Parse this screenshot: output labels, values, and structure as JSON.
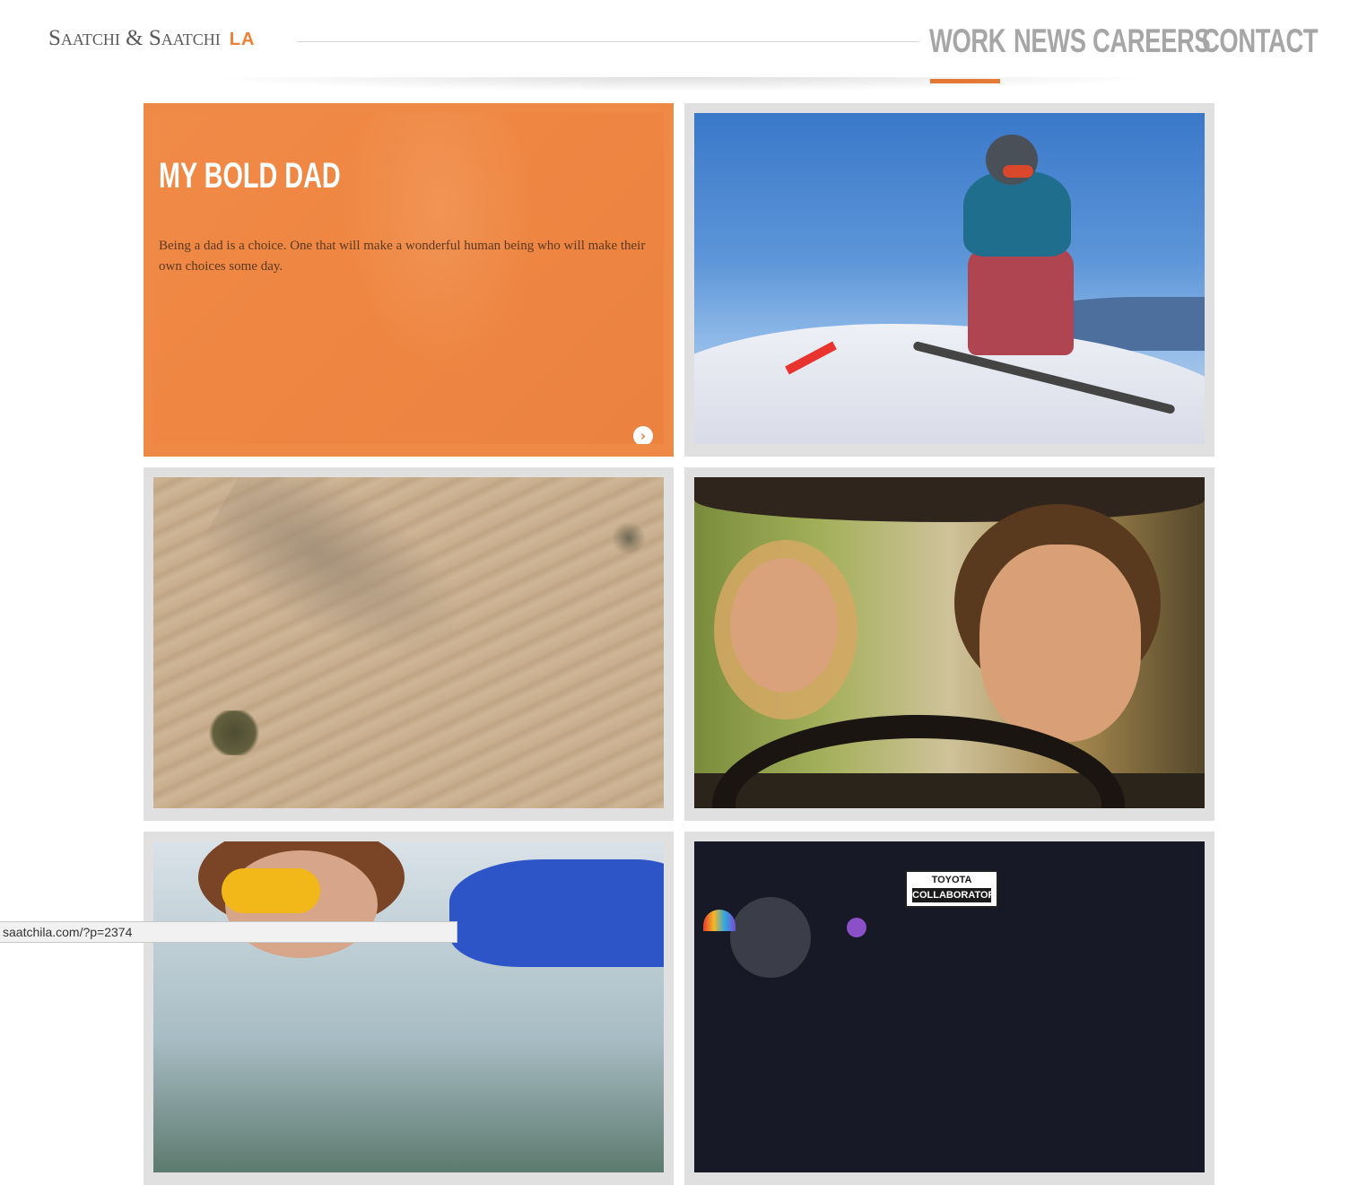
{
  "header": {
    "logo_text": "Saatchi & Saatchi",
    "logo_suffix": "LA",
    "nav": [
      {
        "label": "WORK"
      },
      {
        "label": "NEWS"
      },
      {
        "label": "CAREERS"
      },
      {
        "label": "CONTACT"
      }
    ],
    "active_nav": "WORK"
  },
  "featured": {
    "title": "MY BOLD DAD",
    "description": "Being a dad is a choice. One that will make a wonderful human being who will make their own choices some day.",
    "arrow_icon": "chevron-right-icon"
  },
  "tiles": [
    {
      "image": "snowboarder"
    },
    {
      "image": "desert-dust-trail"
    },
    {
      "image": "newlyweds-in-car"
    },
    {
      "image": "swimmer-with-goggles"
    },
    {
      "image": "toyota-collaborator",
      "badge_line1": "TOYOTA",
      "badge_line2": "COLLABORATOR"
    }
  ],
  "status_bar": {
    "url": "saatchila.com/?p=2374"
  },
  "colors": {
    "accent": "#ee7f35",
    "nav_text": "#a6a6a6",
    "tile_border": "#e0e0e0"
  }
}
